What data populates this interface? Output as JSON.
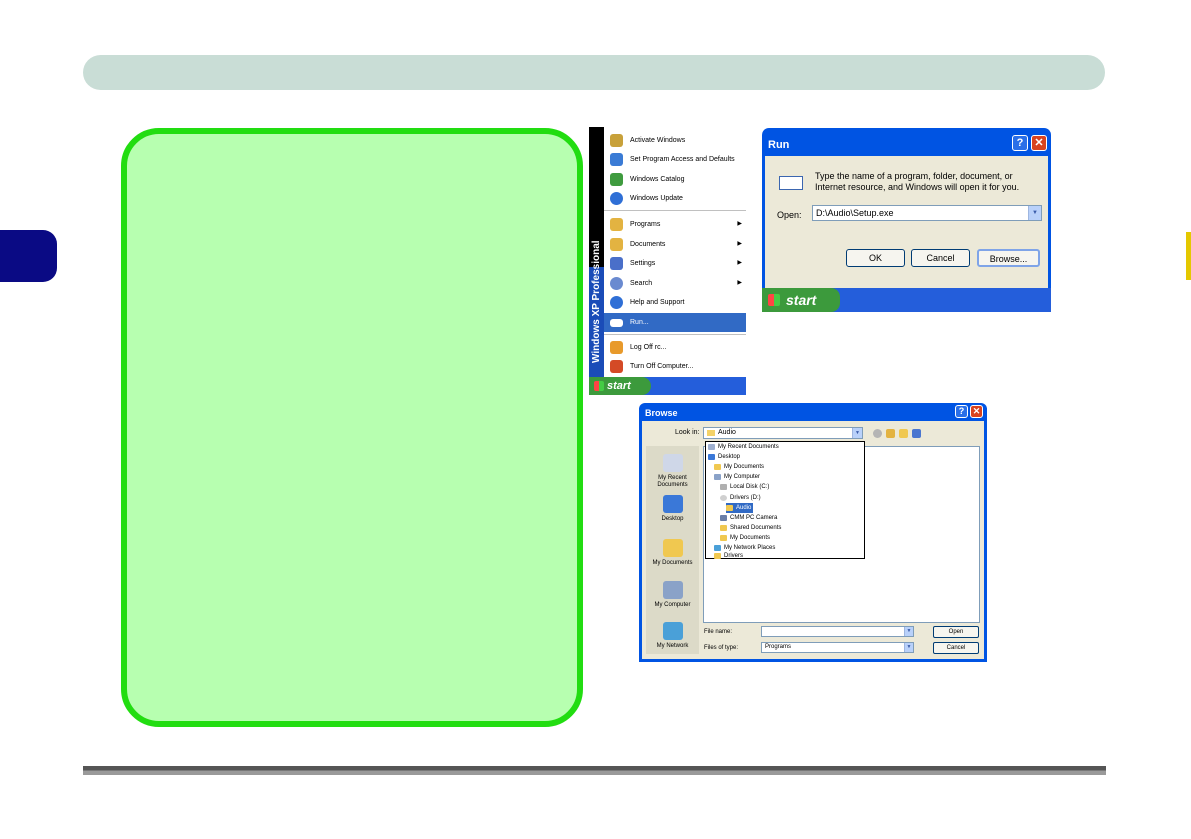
{
  "start_menu": {
    "brand": "Windows XP Professional",
    "items": [
      {
        "label": "Activate Windows",
        "icon": "key-icon",
        "color": "#c8a13a"
      },
      {
        "label": "Set Program Access and Defaults",
        "icon": "program-access-icon",
        "color": "#3a7bd5"
      },
      {
        "label": "Windows Catalog",
        "icon": "catalog-icon",
        "color": "#3f9b3f"
      },
      {
        "label": "Windows Update",
        "icon": "update-icon",
        "color": "#2f6fd6"
      },
      {
        "label": "Programs",
        "icon": "programs-icon",
        "color": "#e3b341"
      },
      {
        "label": "Documents",
        "icon": "documents-icon",
        "color": "#e3b341"
      },
      {
        "label": "Settings",
        "icon": "settings-icon",
        "color": "#4a6fc9"
      },
      {
        "label": "Search",
        "icon": "search-icon",
        "color": "#6a8ad0"
      },
      {
        "label": "Help and Support",
        "icon": "help-icon",
        "color": "#2f6fd6"
      },
      {
        "label": "Run...",
        "icon": "run-icon",
        "color": "#ffffff"
      },
      {
        "label": "Log Off rc...",
        "icon": "logoff-icon",
        "color": "#e89a2b"
      },
      {
        "label": "Turn Off Computer...",
        "icon": "power-icon",
        "color": "#d44a26"
      }
    ],
    "start_label": "start"
  },
  "run_dialog": {
    "title": "Run",
    "help_glyph": "?",
    "close_glyph": "✕",
    "description": "Type the name of a program, folder, document, or Internet resource, and Windows will open it for you.",
    "open_label": "Open:",
    "open_value": "D:\\Audio\\Setup.exe",
    "ok_label": "OK",
    "cancel_label": "Cancel",
    "browse_label": "Browse...",
    "start_label": "start"
  },
  "browse_dialog": {
    "title": "Browse",
    "help_glyph": "?",
    "close_glyph": "✕",
    "look_in_label": "Look in:",
    "look_in_value": "Audio",
    "places": [
      "My Recent Documents",
      "Desktop",
      "My Documents",
      "My Computer",
      "My Network"
    ],
    "dropdown_items": [
      "My Recent Documents",
      "Desktop",
      "My Documents",
      "My Computer",
      "Local Disk (C:)",
      "Drivers (D:)",
      "Audio",
      "CMM PC Camera",
      "Shared Documents",
      "My Documents",
      "My Network Places",
      "Drivers"
    ],
    "file_name_label": "File name:",
    "file_name_value": "",
    "files_of_type_label": "Files of type:",
    "files_of_type_value": "Programs",
    "open_label": "Open",
    "cancel_label": "Cancel"
  },
  "colors": {
    "header_bar": "#c9ddd6",
    "chapter_tab": "#0a0a84",
    "note_fill": "#b7ffb0",
    "note_border": "#22dd11",
    "xp_blue": "#0054e3",
    "start_green": "#3c9a3c"
  }
}
